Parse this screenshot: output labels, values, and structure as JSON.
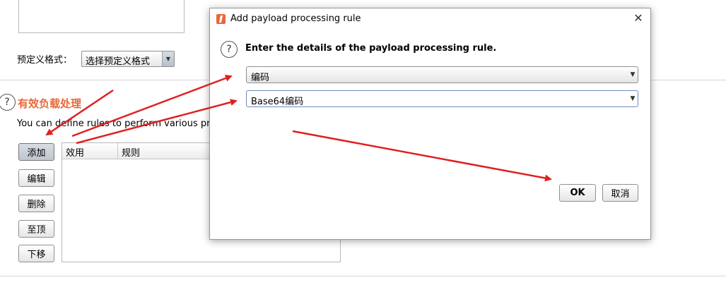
{
  "background": {
    "predefined_format": {
      "label": "预定义格式：",
      "select_value": "选择预定义格式"
    },
    "section": {
      "title": "有效负载处理",
      "description": "You can define rules to perform various pro"
    },
    "buttons": {
      "add": "添加",
      "edit": "编辑",
      "remove": "删除",
      "up": "至顶",
      "down": "下移"
    },
    "table": {
      "columns": [
        "效用",
        "规则"
      ]
    }
  },
  "dialog": {
    "title": "Add payload processing rule",
    "close_glyph": "✕",
    "prompt": "Enter the details of the payload processing rule.",
    "rule_type_value": "编码",
    "rule_option_value": "Base64编码",
    "ok_label": "OK",
    "cancel_label": "取消",
    "help_glyph": "?"
  },
  "icons": {
    "help": "help-circle-icon",
    "app": "burp-app-icon",
    "close": "close-icon",
    "dropdown": "chevron-down-icon"
  },
  "colors": {
    "section_title": "#e8683a",
    "annotation_arrow": "#e02020"
  }
}
